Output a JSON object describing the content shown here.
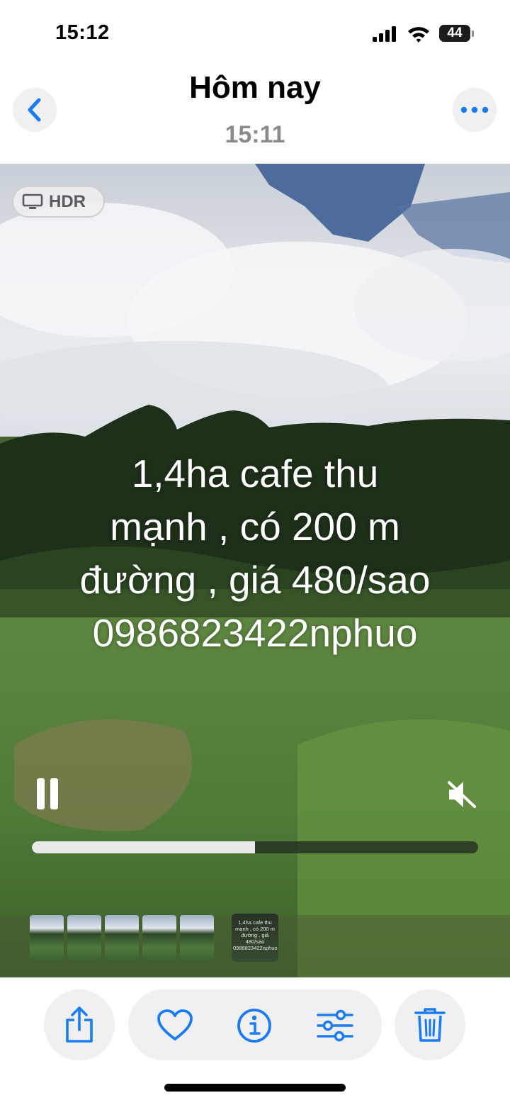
{
  "status_bar": {
    "time": "15:12",
    "battery": "44"
  },
  "header": {
    "title": "Hôm nay",
    "subtitle": "15:11"
  },
  "media": {
    "hdr_label": "HDR",
    "overlay_lines": [
      "1,4ha cafe thu",
      "mạnh  , có 200 m",
      "đường  , giá 480/sao",
      "0986823422nphuo"
    ],
    "playback_progress": 0.5,
    "filmstrip_selected_text": "1,4ha cafe thu mạnh , có 200 m đường , giá 480/sao 0986823422nphuo"
  },
  "colors": {
    "accent": "#1a7cf5",
    "panel": "#f0f0f2",
    "subtitle": "#8a8a8e"
  },
  "icons": {
    "back": "chevron-left-icon",
    "more": "ellipsis-icon",
    "hdr": "display-icon",
    "pause": "pause-icon",
    "mute": "speaker-muted-icon",
    "share": "share-icon",
    "favorite": "heart-icon",
    "info": "info-icon",
    "adjust": "sliders-icon",
    "delete": "trash-icon"
  }
}
